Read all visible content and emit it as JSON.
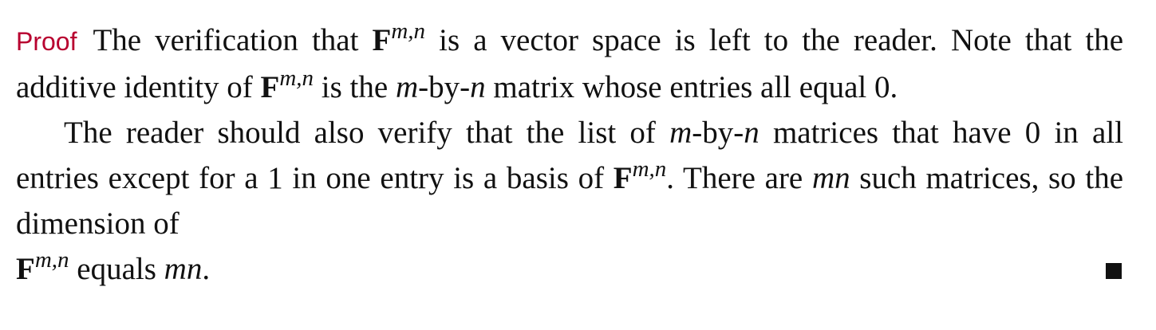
{
  "proof": {
    "label": "Proof",
    "p1": {
      "t1": "The verification that",
      "F": "F",
      "sup": "m,n",
      "t2": "is a vector space is left to the reader. Note that the additive identity of",
      "t3": "is the",
      "m": "m",
      "by": "-by-",
      "n": "n",
      "t4": "matrix whose entries all equal 0."
    },
    "p2": {
      "t1": "The reader should also verify that the list of",
      "t2": "matrices that have 0 in all entries except for a 1 in one entry is a basis of",
      "t3": ". There are",
      "mn": "mn",
      "t4": "such matrices, so the dimension of",
      "t5": "equals",
      "t6": "."
    },
    "qed_symbol": "end-of-proof-square"
  }
}
